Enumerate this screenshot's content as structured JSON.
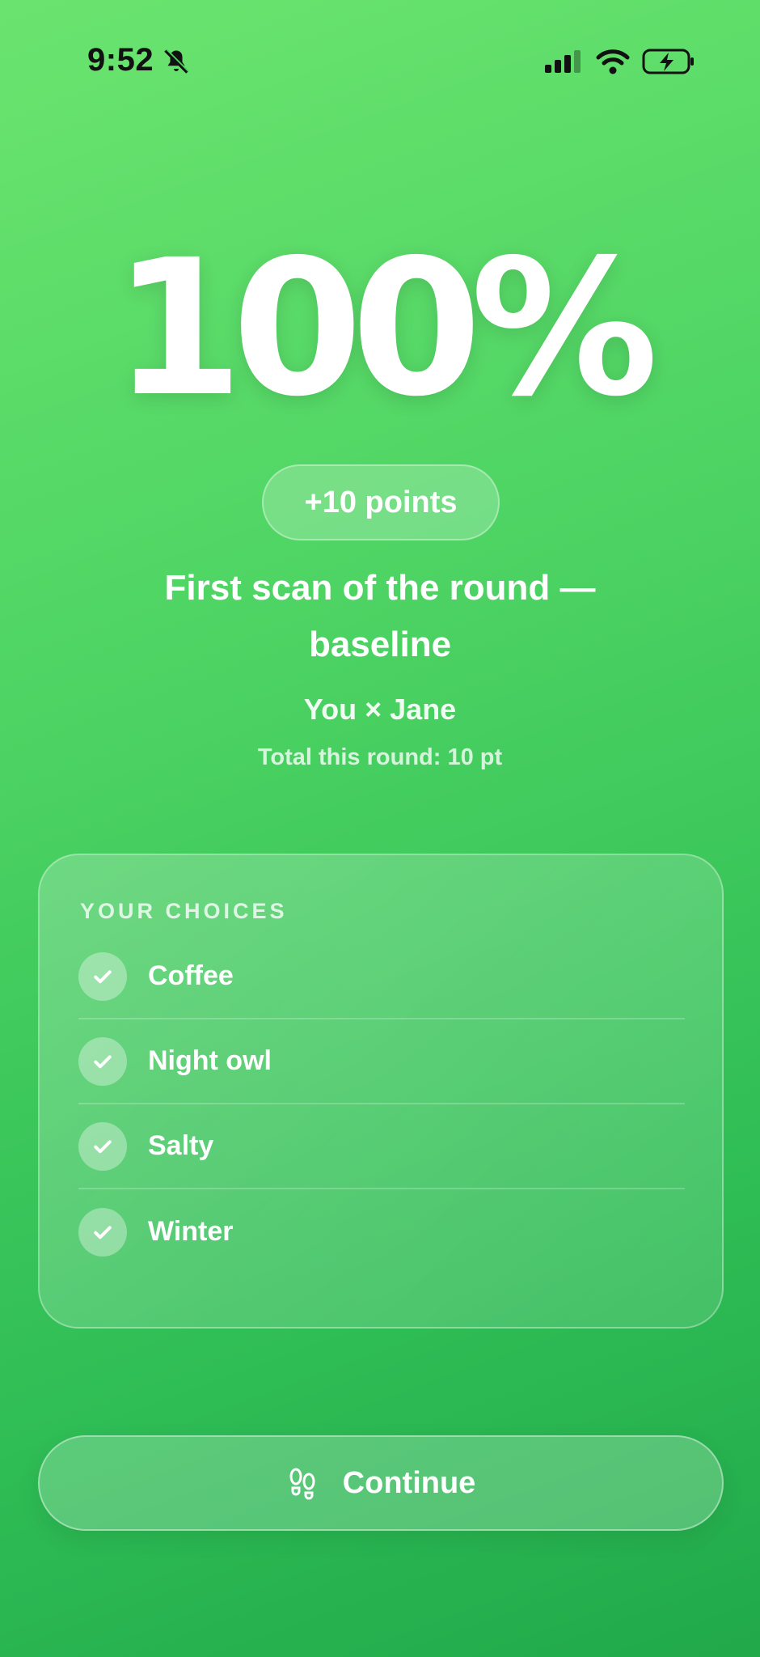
{
  "status_bar": {
    "time": "9:52",
    "icons": [
      "bell-slash-icon",
      "cellular-signal-icon",
      "wifi-icon",
      "battery-charging-icon"
    ]
  },
  "result": {
    "percent": "100%",
    "points": "+10 points",
    "headline": "First scan of the round — baseline",
    "pair": "You × Jane",
    "total": "Total this round: 10 pt"
  },
  "choices": {
    "title": "YOUR CHOICES",
    "items": [
      {
        "label": "Coffee"
      },
      {
        "label": "Night owl"
      },
      {
        "label": "Salty"
      },
      {
        "label": "Winter"
      }
    ]
  },
  "footer": {
    "continue_label": "Continue",
    "continue_icon": "footprints-icon"
  },
  "colors": {
    "background_top": "#6be46f",
    "background_bottom": "#21a94a",
    "text": "#ffffff"
  }
}
